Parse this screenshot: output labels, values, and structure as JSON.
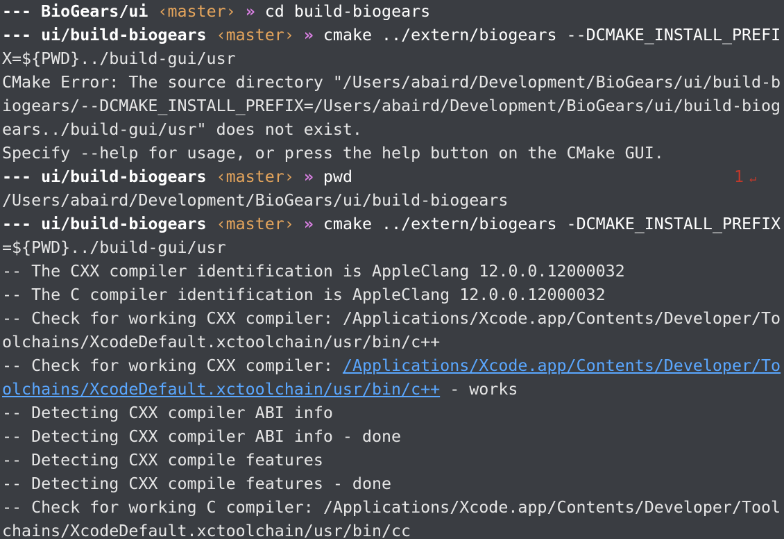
{
  "terminal": {
    "lines": [
      {
        "type": "prompt",
        "prefix": "---",
        "path": "BioGears/ui",
        "branch": "‹master›",
        "arrow": "»",
        "cmd": "cd build-biogears"
      },
      {
        "type": "prompt",
        "prefix": "---",
        "path": "ui/build-biogears",
        "branch": "‹master›",
        "arrow": "»",
        "cmd": "cmake ../extern/biogears --DCMAKE_INSTALL_PREFI"
      },
      {
        "type": "out",
        "text": "X=${PWD}../build-gui/usr"
      },
      {
        "type": "out",
        "text": "CMake Error: The source directory \"/Users/abaird/Development/BioGears/ui/build-b"
      },
      {
        "type": "out",
        "text": "iogears/--DCMAKE_INSTALL_PREFIX=/Users/abaird/Development/BioGears/ui/build-biog"
      },
      {
        "type": "out",
        "text": "ears../build-gui/usr\" does not exist."
      },
      {
        "type": "out",
        "text": "Specify --help for usage, or press the help button on the CMake GUI."
      },
      {
        "type": "prompt",
        "prefix": "---",
        "path": "ui/build-biogears",
        "branch": "‹master›",
        "arrow": "»",
        "cmd": "pwd",
        "status": "1",
        "status_icon": "↵"
      },
      {
        "type": "out",
        "text": "/Users/abaird/Development/BioGears/ui/build-biogears"
      },
      {
        "type": "prompt",
        "prefix": "---",
        "path": "ui/build-biogears",
        "branch": "‹master›",
        "arrow": "»",
        "cmd": "cmake ../extern/biogears -DCMAKE_INSTALL_PREFIX"
      },
      {
        "type": "out",
        "text": "=${PWD}../build-gui/usr"
      },
      {
        "type": "out",
        "text": "-- The CXX compiler identification is AppleClang 12.0.0.12000032"
      },
      {
        "type": "out",
        "text": "-- The C compiler identification is AppleClang 12.0.0.12000032"
      },
      {
        "type": "out",
        "text": "-- Check for working CXX compiler: /Applications/Xcode.app/Contents/Developer/To"
      },
      {
        "type": "out",
        "text": "olchains/XcodeDefault.xctoolchain/usr/bin/c++"
      },
      {
        "type": "mixed",
        "pre": "-- Check for working CXX compiler: ",
        "link": "/Applications/Xcode.app/Contents/Developer/To",
        "post": ""
      },
      {
        "type": "mixed",
        "pre": "",
        "link": "olchains/XcodeDefault.xctoolchain/usr/bin/c++",
        "post": " - works"
      },
      {
        "type": "out",
        "text": "-- Detecting CXX compiler ABI info"
      },
      {
        "type": "out",
        "text": "-- Detecting CXX compiler ABI info - done"
      },
      {
        "type": "out",
        "text": "-- Detecting CXX compile features"
      },
      {
        "type": "out",
        "text": "-- Detecting CXX compile features - done"
      },
      {
        "type": "out",
        "text": "-- Check for working C compiler: /Applications/Xcode.app/Contents/Developer/Tool"
      },
      {
        "type": "out",
        "text": "chains/XcodeDefault.xctoolchain/usr/bin/cc"
      }
    ]
  }
}
